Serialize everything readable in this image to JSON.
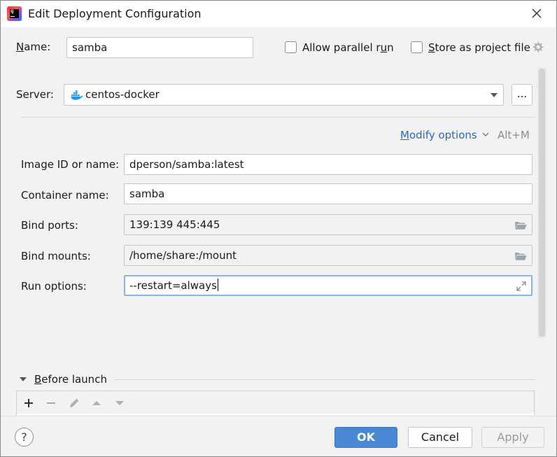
{
  "window": {
    "title": "Edit Deployment Configuration"
  },
  "name": {
    "label_mnemonic": "N",
    "label_rest": "ame:",
    "value": "samba"
  },
  "allow_parallel": {
    "label_before": "Allow parallel r",
    "label_mnemonic": "u",
    "label_after": "n",
    "checked": false
  },
  "store_project": {
    "label_mnemonic": "S",
    "label_rest": "tore as project file",
    "checked": false
  },
  "server": {
    "label": "Server:",
    "value": "centos-docker",
    "icon": "docker-whale-icon",
    "more_label": "..."
  },
  "modify_options": {
    "label_mnemonic": "M",
    "label_rest": "odify options",
    "shortcut": "Alt+M"
  },
  "fields": {
    "image": {
      "label": "Image ID or name:",
      "value": "dperson/samba:latest"
    },
    "container": {
      "label": "Container name:",
      "value": "samba"
    },
    "ports": {
      "label": "Bind ports:",
      "value": "139:139 445:445"
    },
    "mounts": {
      "label": "Bind mounts:",
      "value": "/home/share:/mount"
    },
    "run": {
      "label": "Run options:",
      "value": "--restart=always"
    }
  },
  "before_launch": {
    "label_mnemonic": "B",
    "label_rest": "efore launch"
  },
  "buttons": {
    "help": "?",
    "ok": "OK",
    "cancel": "Cancel",
    "apply": "Apply"
  },
  "colors": {
    "accent": "#4a88d5",
    "link": "#2f65ca",
    "focus": "#87b4f0",
    "docker": "#2496ed"
  }
}
